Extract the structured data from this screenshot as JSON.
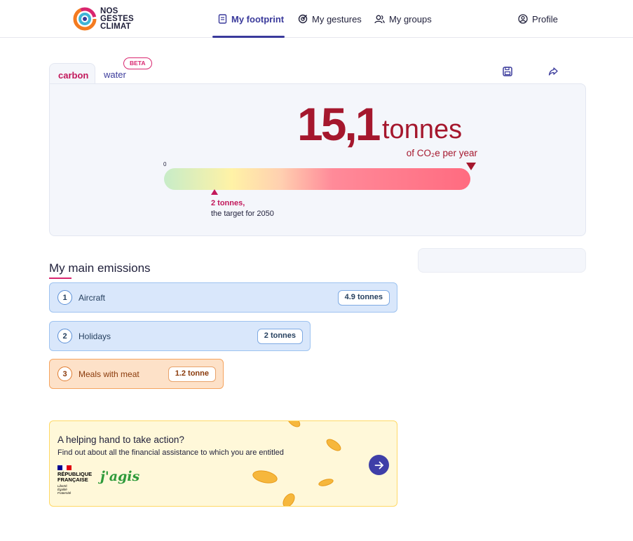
{
  "header": {
    "logo_lines": [
      "NOS",
      "GESTES",
      "CLIMAT"
    ],
    "nav": {
      "footprint": "My footprint",
      "gestures": "My gestures",
      "groups": "My groups",
      "profile": "Profile"
    }
  },
  "tabs": {
    "carbon": "carbon",
    "water": "water",
    "beta": "BETA"
  },
  "footprint": {
    "value": "15,1",
    "unit": "tonnes",
    "sub_unit": "of CO₂e per year",
    "gauge_start": "0",
    "target_value": "2 tonnes,",
    "target_text": "the target for 2050"
  },
  "emissions": {
    "title": "My main emissions",
    "items": [
      {
        "rank": "1",
        "label": "Aircraft",
        "value": "4.9 tonnes"
      },
      {
        "rank": "2",
        "label": "Holidays",
        "value": "2 tonnes"
      },
      {
        "rank": "3",
        "label": "Meals with meat",
        "value": "1.2 tonne"
      }
    ]
  },
  "help": {
    "title": "A helping hand to take action?",
    "text": "Find out about all the financial assistance to which you are entitled",
    "rf_lines": [
      "RÉPUBLIQUE",
      "FRANÇAISE"
    ],
    "rf_motto": [
      "Liberté",
      "Égalité",
      "Fraternité"
    ],
    "jagis": "j'agis"
  },
  "colors": {
    "brand": "#3a3a9b",
    "accent": "#d9266f",
    "footprint": "#a5172d"
  }
}
